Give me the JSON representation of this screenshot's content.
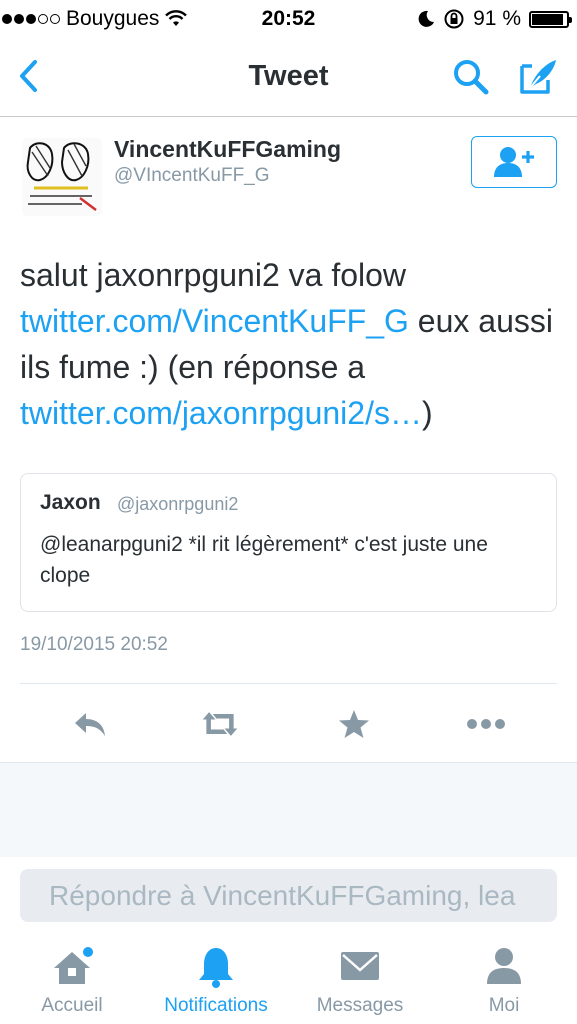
{
  "status_bar": {
    "carrier": "Bouygues",
    "time": "20:52",
    "battery": "91 %"
  },
  "nav": {
    "title": "Tweet",
    "back_icon": "chevron-left-icon",
    "search_icon": "search-icon",
    "compose_icon": "compose-icon"
  },
  "tweet": {
    "author_name": "VincentKuFFGaming",
    "author_handle": "@VIncentKuFF_G",
    "text_part1": "salut jaxonrpguni2 va folow ",
    "link1": "twitter.com/VincentKuFF_G",
    "text_part2": " eux aussi ils fume :) (en réponse a ",
    "link2": "twitter.com/jaxonrpguni2/s…",
    "text_part3": ")",
    "timestamp": "19/10/2015 20:52"
  },
  "quoted": {
    "name": "Jaxon",
    "handle": "@jaxonrpguni2",
    "text": "@leanarpguni2 *il rit légèrement* c'est juste une clope"
  },
  "reply": {
    "placeholder": "Répondre à VincentKuFFGaming, lea"
  },
  "tabs": [
    {
      "label": "Accueil",
      "icon": "home-icon"
    },
    {
      "label": "Notifications",
      "icon": "bell-icon"
    },
    {
      "label": "Messages",
      "icon": "envelope-icon"
    },
    {
      "label": "Moi",
      "icon": "person-icon"
    }
  ],
  "colors": {
    "accent": "#1da1f2",
    "muted": "#8899a6",
    "text": "#292f33"
  }
}
